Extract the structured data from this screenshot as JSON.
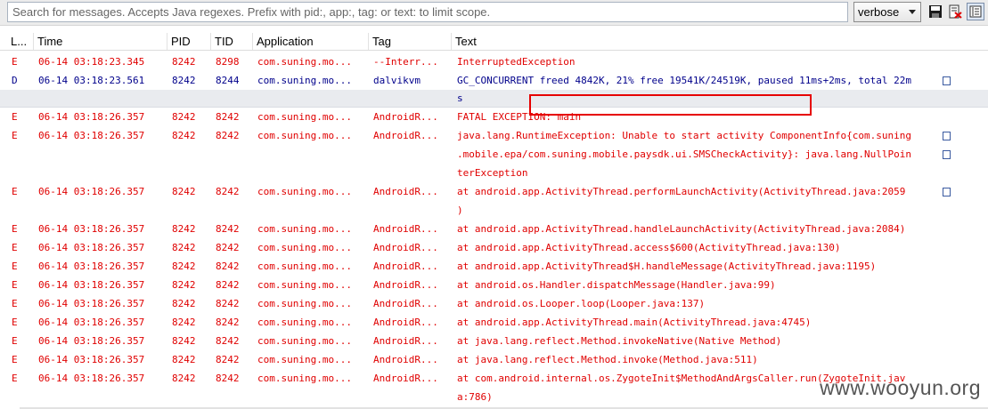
{
  "search": {
    "placeholder": "Search for messages. Accepts Java regexes. Prefix with pid:, app:, tag: or text: to limit scope."
  },
  "toolbar": {
    "level_value": "verbose",
    "save_icon": "save-icon",
    "clear_icon": "clear-log-icon",
    "scroll_lock_icon": "scroll-lock-icon"
  },
  "columns": {
    "level": "L...",
    "time": "Time",
    "pid": "PID",
    "tid": "TID",
    "application": "Application",
    "tag": "Tag",
    "text": "Text"
  },
  "rows": [
    {
      "level": "E",
      "time": "06-14 03:18:23.345",
      "pid": "8242",
      "tid": "8298",
      "app": "com.suning.mo...",
      "tag": "--Interr...",
      "text": "InterruptedException"
    },
    {
      "level": "D",
      "time": "06-14 03:18:23.561",
      "pid": "8242",
      "tid": "8244",
      "app": "com.suning.mo...",
      "tag": "dalvikvm",
      "text": "GC_CONCURRENT freed 4842K, 21% free 19541K/24519K, paused 11ms+2ms, total 22m",
      "text2": "s"
    },
    {
      "level": "E",
      "time": "06-14 03:18:26.357",
      "pid": "8242",
      "tid": "8242",
      "app": "com.suning.mo...",
      "tag": "AndroidR...",
      "text": "FATAL EXCEPTION: main"
    },
    {
      "level": "E",
      "time": "06-14 03:18:26.357",
      "pid": "8242",
      "tid": "8242",
      "app": "com.suning.mo...",
      "tag": "AndroidR...",
      "text": "java.lang.RuntimeException: Unable to start activity ComponentInfo{com.suning",
      "text2": ".mobile.epa/com.suning.mobile.paysdk.ui.SMSCheckActivity}: java.lang.NullPoin",
      "text3": "terException"
    },
    {
      "level": "E",
      "time": "06-14 03:18:26.357",
      "pid": "8242",
      "tid": "8242",
      "app": "com.suning.mo...",
      "tag": "AndroidR...",
      "text": "at android.app.ActivityThread.performLaunchActivity(ActivityThread.java:2059",
      "text2": ")"
    },
    {
      "level": "E",
      "time": "06-14 03:18:26.357",
      "pid": "8242",
      "tid": "8242",
      "app": "com.suning.mo...",
      "tag": "AndroidR...",
      "text": "at android.app.ActivityThread.handleLaunchActivity(ActivityThread.java:2084)"
    },
    {
      "level": "E",
      "time": "06-14 03:18:26.357",
      "pid": "8242",
      "tid": "8242",
      "app": "com.suning.mo...",
      "tag": "AndroidR...",
      "text": "at android.app.ActivityThread.access$600(ActivityThread.java:130)"
    },
    {
      "level": "E",
      "time": "06-14 03:18:26.357",
      "pid": "8242",
      "tid": "8242",
      "app": "com.suning.mo...",
      "tag": "AndroidR...",
      "text": "at android.app.ActivityThread$H.handleMessage(ActivityThread.java:1195)"
    },
    {
      "level": "E",
      "time": "06-14 03:18:26.357",
      "pid": "8242",
      "tid": "8242",
      "app": "com.suning.mo...",
      "tag": "AndroidR...",
      "text": "at android.os.Handler.dispatchMessage(Handler.java:99)"
    },
    {
      "level": "E",
      "time": "06-14 03:18:26.357",
      "pid": "8242",
      "tid": "8242",
      "app": "com.suning.mo...",
      "tag": "AndroidR...",
      "text": "at android.os.Looper.loop(Looper.java:137)"
    },
    {
      "level": "E",
      "time": "06-14 03:18:26.357",
      "pid": "8242",
      "tid": "8242",
      "app": "com.suning.mo...",
      "tag": "AndroidR...",
      "text": "at android.app.ActivityThread.main(ActivityThread.java:4745)"
    },
    {
      "level": "E",
      "time": "06-14 03:18:26.357",
      "pid": "8242",
      "tid": "8242",
      "app": "com.suning.mo...",
      "tag": "AndroidR...",
      "text": "at java.lang.reflect.Method.invokeNative(Native Method)"
    },
    {
      "level": "E",
      "time": "06-14 03:18:26.357",
      "pid": "8242",
      "tid": "8242",
      "app": "com.suning.mo...",
      "tag": "AndroidR...",
      "text": "at java.lang.reflect.Method.invoke(Method.java:511)"
    },
    {
      "level": "E",
      "time": "06-14 03:18:26.357",
      "pid": "8242",
      "tid": "8242",
      "app": "com.suning.mo...",
      "tag": "AndroidR...",
      "text": "at com.android.internal.os.ZygoteInit$MethodAndArgsCaller.run(ZygoteInit.jav",
      "text2": "a:786)"
    }
  ],
  "watermark": "www.wooyun.org",
  "colors": {
    "error": "#e00000",
    "debug": "#00008b",
    "highlight_box": "#e60000"
  }
}
